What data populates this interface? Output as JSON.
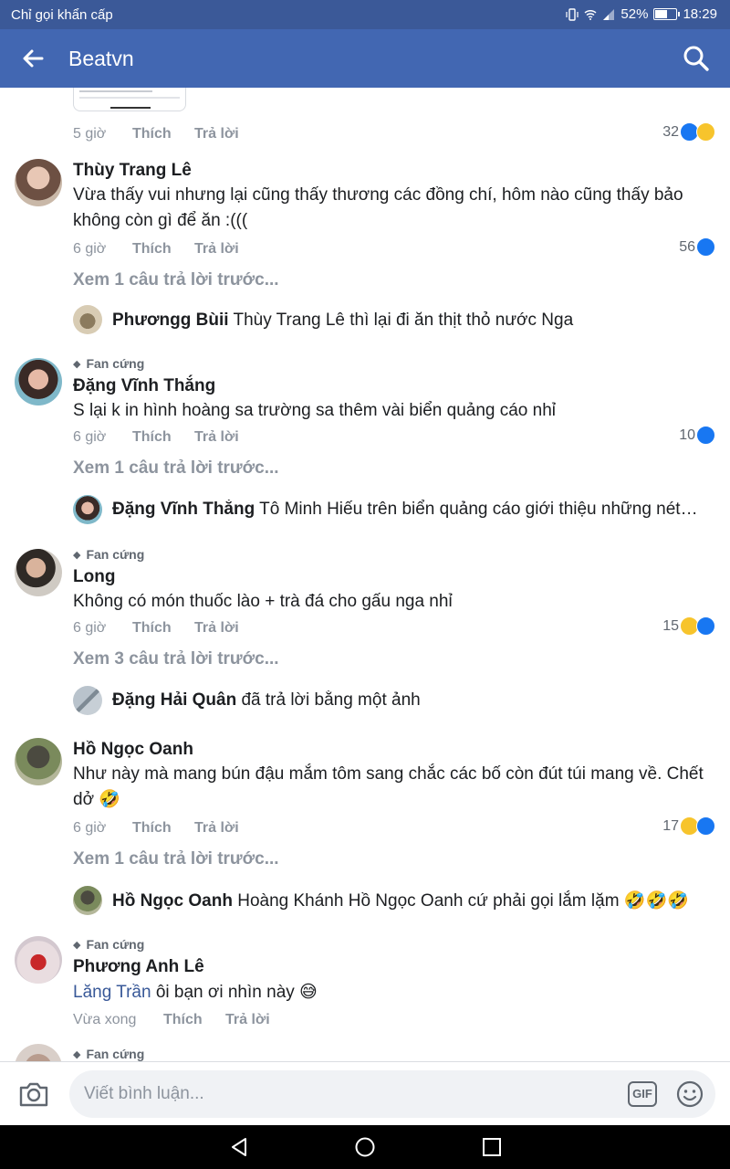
{
  "status_bar": {
    "carrier": "Chỉ gọi khẩn cấp",
    "battery": "52%",
    "battery_level": 0.52,
    "time": "18:29"
  },
  "header": {
    "title": "Beatvn",
    "back_icon": "arrow-left-icon",
    "search_icon": "search-icon"
  },
  "colors": {
    "brand": "#4267b2",
    "status_bar": "#3b5998",
    "like": "#1877f2",
    "haha": "#f7c42c",
    "muted": "#8d949e",
    "link": "#385898"
  },
  "labels": {
    "like": "Thích",
    "reply": "Trả lời",
    "fan_badge": "Fan cứng"
  },
  "previous_comment": {
    "time": "5 giờ",
    "reactions": "32",
    "reaction_icons": [
      "like",
      "haha"
    ]
  },
  "comments": [
    {
      "name": "Thùy Trang Lê",
      "text": "Vừa thấy vui nhưng lại cũng thấy thương các đồng chí, hôm nào cũng thấy bảo không còn gì để ăn :(((",
      "time": "6 giờ",
      "reactions": "56",
      "reaction_icons": [
        "like"
      ],
      "more_replies": "Xem 1 câu trả lời trước...",
      "reply": {
        "name": "Phươngg Bùii",
        "text": "Thùy Trang Lê thì lại đi ăn thịt thỏ nước Nga"
      }
    },
    {
      "badge": "Fan cứng",
      "name": "Đặng Vĩnh Thắng",
      "text": "S lại k in hình hoàng sa trường sa thêm vài biển quảng cáo nhỉ",
      "time": "6 giờ",
      "reactions": "10",
      "reaction_icons": [
        "like"
      ],
      "more_replies": "Xem 1 câu trả lời trước...",
      "reply": {
        "name": "Đặng Vĩnh Thắng",
        "text": "Tô Minh Hiếu trên biển quảng cáo giới thiệu những nét…"
      }
    },
    {
      "badge": "Fan cứng",
      "name": "Long",
      "text": "Không có món thuốc lào + trà đá cho gấu nga nhỉ",
      "time": "6 giờ",
      "reactions": "15",
      "reaction_icons": [
        "haha",
        "like"
      ],
      "more_replies": "Xem 3 câu trả lời trước...",
      "reply": {
        "name": "Đặng Hải Quân",
        "text": "đã trả lời bằng một ảnh"
      }
    },
    {
      "name": "Hồ Ngọc Oanh",
      "text": "Như này mà mang bún đậu mắm tôm sang chắc các bố còn đút túi mang về. Chết dở 🤣",
      "time": "6 giờ",
      "reactions": "17",
      "reaction_icons": [
        "haha",
        "like"
      ],
      "more_replies": "Xem 1 câu trả lời trước...",
      "reply": {
        "name": "Hồ Ngọc Oanh",
        "text": "Hoàng Khánh Hồ Ngọc Oanh cứ phải gọi lắm lặm 🤣🤣🤣"
      }
    },
    {
      "badge": "Fan cứng",
      "name": "Phương Anh Lê",
      "mention": "Lăng Trần",
      "text": " ôi bạn ơi nhìn này 😅",
      "time": "Vừa xong"
    },
    {
      "badge": "Fan cứng"
    }
  ],
  "composer": {
    "placeholder": "Viết bình luận...",
    "gif_label": "GIF",
    "camera_icon": "camera-icon",
    "emoji_icon": "smiley-icon"
  },
  "nav": {
    "back_icon": "triangle-back-icon",
    "home_icon": "circle-home-icon",
    "recents_icon": "square-recents-icon"
  }
}
